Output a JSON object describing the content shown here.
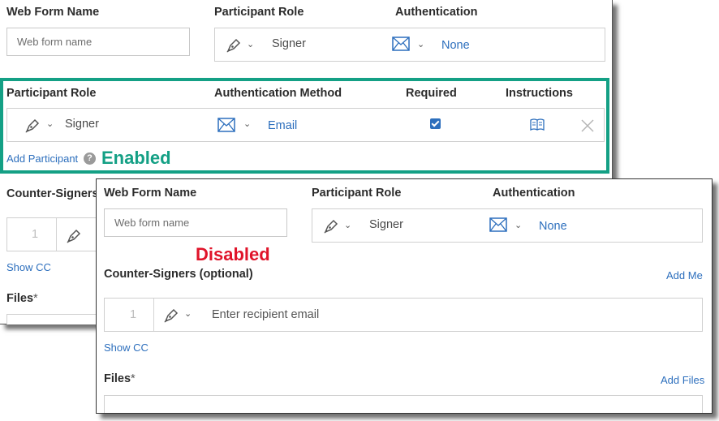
{
  "enabled_panel": {
    "web_form_name_label": "Web Form Name",
    "web_form_name_placeholder": "Web form name",
    "participant_role_label": "Participant Role",
    "role_value": "Signer",
    "authentication_label": "Authentication",
    "authentication_value": "None",
    "table": {
      "headers": [
        "Participant Role",
        "Authentication Method",
        "Required",
        "Instructions"
      ],
      "row": {
        "role": "Signer",
        "auth_method": "Email",
        "required": true
      }
    },
    "add_participant": "Add Participant",
    "help_icon_glyph": "?",
    "enabled_label": "Enabled",
    "counter_signers_label": "Counter-Signers",
    "counter_index": "1",
    "show_cc": "Show CC",
    "files_label": "Files",
    "files_required_mark": "*"
  },
  "disabled_panel": {
    "web_form_name_label": "Web Form Name",
    "web_form_name_placeholder": "Web form name",
    "participant_role_label": "Participant Role",
    "role_value": "Signer",
    "authentication_label": "Authentication",
    "authentication_value": "None",
    "disabled_label": "Disabled",
    "counter_signers_label": "Counter-Signers (optional)",
    "add_me": "Add Me",
    "counter_index": "1",
    "recipient_email_placeholder": "Enter recipient email",
    "show_cc": "Show CC",
    "files_label": "Files",
    "files_required_mark": "*",
    "add_files": "Add Files"
  },
  "icons": {
    "pen": "pen-nib-icon",
    "mail": "envelope-icon",
    "chevron": "chevron-down-icon",
    "book": "open-book-icon",
    "close": "close-icon",
    "help": "help-circle-icon",
    "check": "checkbox-checked"
  },
  "colors": {
    "enabled": "#14a085",
    "disabled": "#e0142a",
    "link": "#2d6fbd"
  }
}
